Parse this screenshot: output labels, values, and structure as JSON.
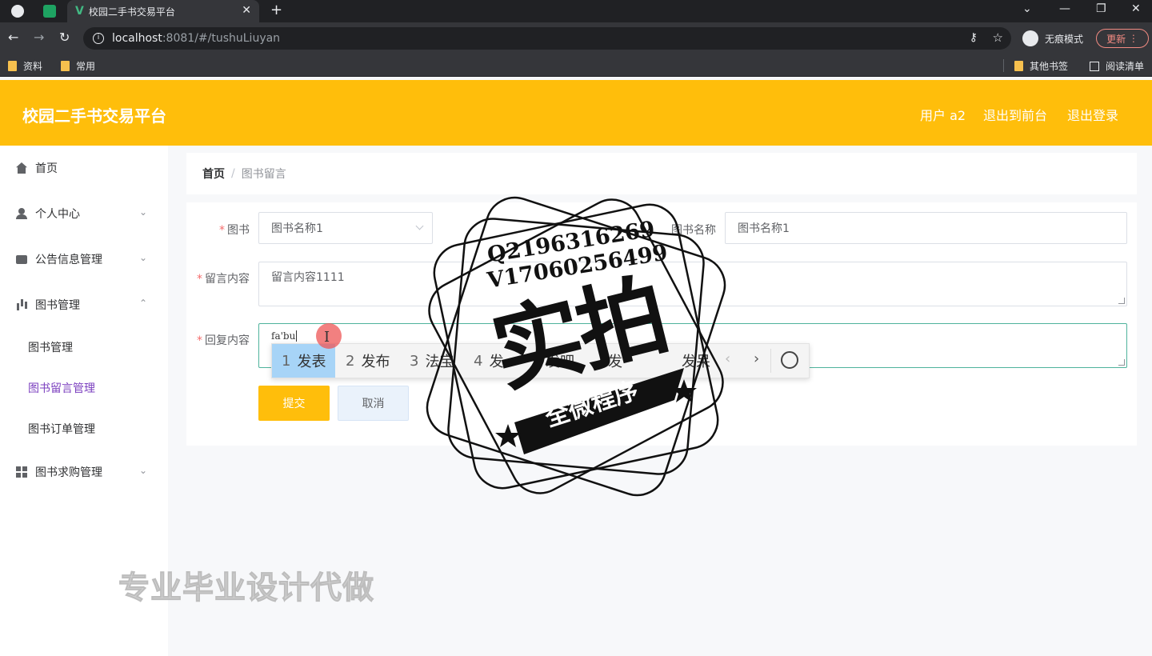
{
  "browser": {
    "tab_title": "校园二手书交易平台",
    "url_host": "localhost",
    "url_path": ":8081/#/tushuLiuyan",
    "incognito_label": "无痕模式",
    "update_label": "更新",
    "bookmarks": [
      "资料",
      "常用"
    ],
    "other_bookmarks": "其他书签",
    "reading_list": "阅读清单"
  },
  "header": {
    "brand": "校园二手书交易平台",
    "user": "用户 a2",
    "to_front": "退出到前台",
    "logout": "退出登录",
    "color": "#ffbe0b"
  },
  "sidebar": {
    "items": [
      {
        "label": "首页",
        "icon": "home-icon"
      },
      {
        "label": "个人中心",
        "icon": "user-icon"
      },
      {
        "label": "公告信息管理",
        "icon": "chat-icon"
      },
      {
        "label": "图书管理",
        "icon": "bar-chart-icon"
      },
      {
        "label": "图书求购管理",
        "icon": "grid-icon"
      }
    ],
    "subitems": [
      "图书管理",
      "图书留言管理",
      "图书订单管理"
    ],
    "active_color": "#7b3fbf"
  },
  "breadcrumb": {
    "home": "首页",
    "separator": "/",
    "current": "图书留言"
  },
  "form": {
    "book_label": "图书",
    "book_value": "图书名称1",
    "book_name_label": "图书名称",
    "book_name_value": "图书名称1",
    "message_label": "留言内容",
    "message_value": "留言内容1111",
    "reply_label": "回复内容",
    "reply_value": "fa'bu",
    "submit_label": "提交",
    "cancel_label": "取消"
  },
  "ime": {
    "candidates": [
      {
        "num": "1",
        "text": "发表"
      },
      {
        "num": "2",
        "text": "发布"
      },
      {
        "num": "3",
        "text": "法宝"
      },
      {
        "num": "4",
        "text": "发"
      },
      {
        "num": "",
        "text": "发吧"
      },
      {
        "num": "",
        "text": "发"
      },
      {
        "num": "",
        "text": "发呆"
      }
    ],
    "prev": "‹",
    "next": "›"
  },
  "watermark": {
    "qq": "Q2196316269",
    "wx": "V17060256499",
    "big": "实拍",
    "ribbon": "全微程序",
    "ad": "专业毕业设计代做"
  }
}
